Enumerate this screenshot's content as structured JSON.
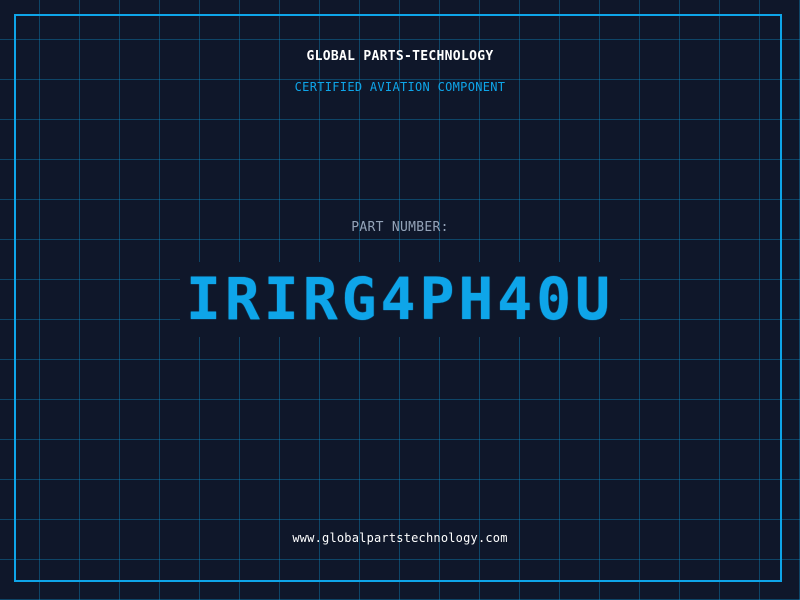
{
  "header": {
    "company_name": "GLOBAL PARTS-TECHNOLOGY",
    "tagline": "CERTIFIED AVIATION COMPONENT"
  },
  "part": {
    "label": "PART NUMBER:",
    "number": "IRIRG4PH40U"
  },
  "footer": {
    "website": "www.globalpartstechnology.com"
  },
  "colors": {
    "background": "#0f172a",
    "accent": "#0ea5e9",
    "grid": "#0ea5e9",
    "text_primary": "#ffffff",
    "text_muted": "#94a3b8"
  }
}
